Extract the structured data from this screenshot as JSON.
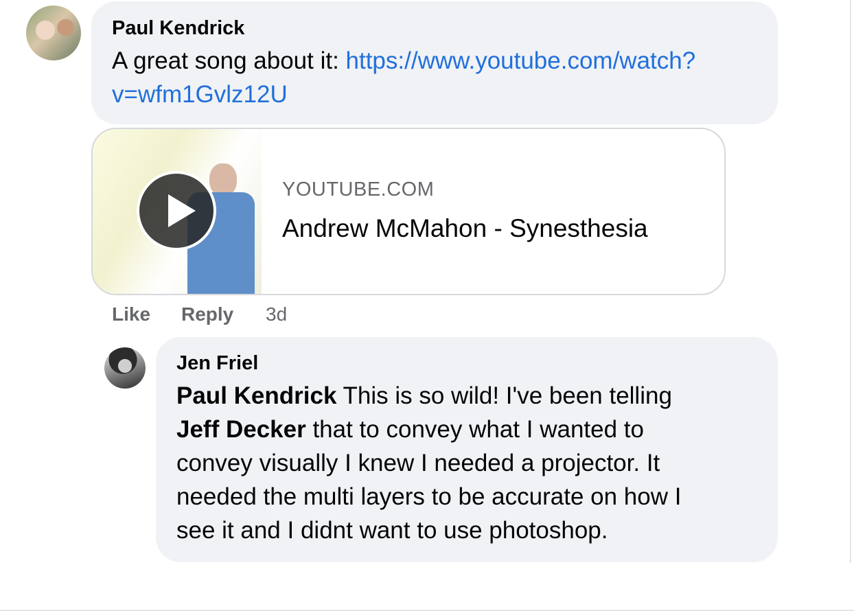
{
  "comment": {
    "author": "Paul Kendrick",
    "text_prefix": "A great song about it: ",
    "link_line1": "https://www.youtube.com/watch?",
    "link_line2": "v=wfm1Gvlz12U",
    "link_preview": {
      "source": "YOUTUBE.COM",
      "title": "Andrew McMahon - Synesthesia"
    },
    "actions": {
      "like": "Like",
      "reply": "Reply",
      "time": "3d"
    }
  },
  "reply": {
    "author": "Jen Friel",
    "mention1": "Paul Kendrick",
    "line1_rest": " This is so wild! I've been telling",
    "mention2": "Jeff Decker",
    "line2_rest": " that to convey what I wanted to",
    "line3": "convey visually I knew I needed a projector. It",
    "line4": "needed the multi layers to be accurate on how I",
    "line5": "see it and I didnt want to use photoshop."
  },
  "colors": {
    "bubble": "#f0f2f5",
    "link": "#216fdb",
    "secondary_text": "#65676b"
  }
}
